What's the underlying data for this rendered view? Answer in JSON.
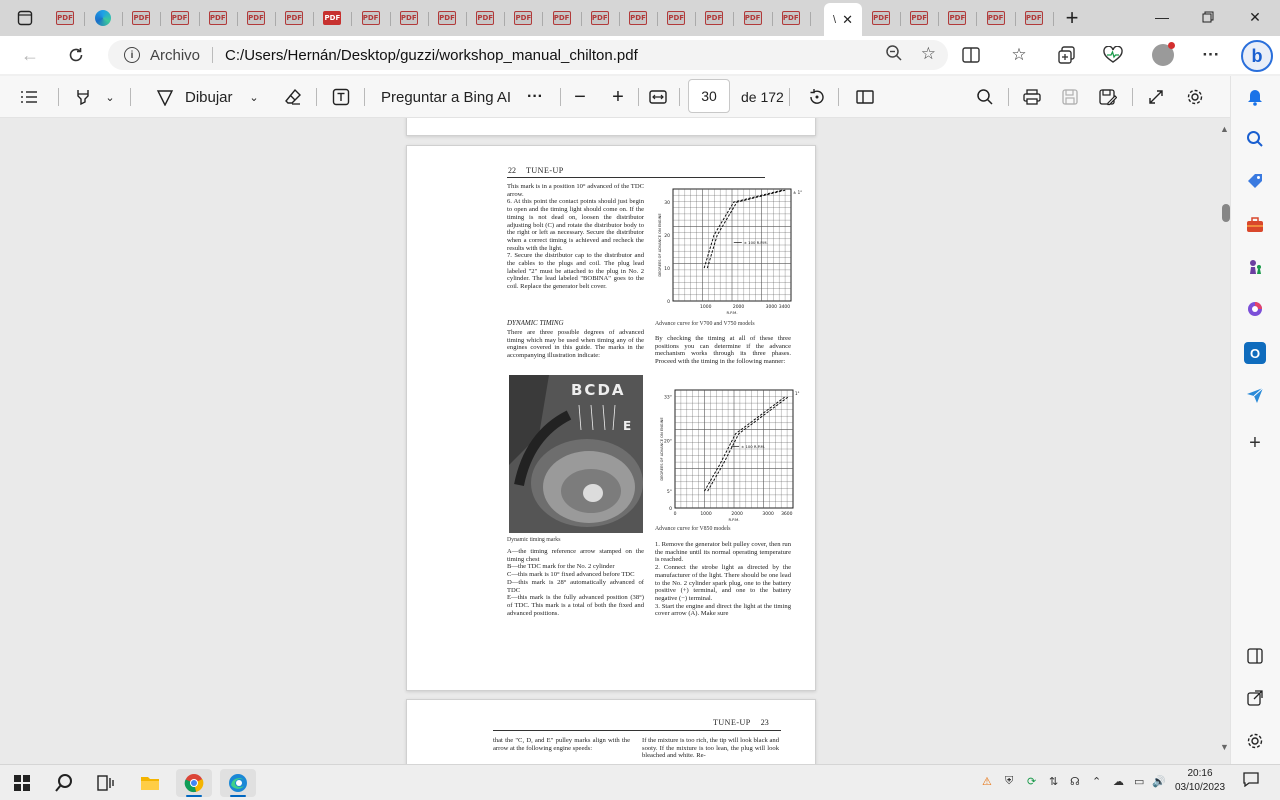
{
  "browser": {
    "tabs": [
      {
        "fav": "PDF"
      },
      {
        "fav": "edge"
      },
      {
        "fav": "PDF"
      },
      {
        "fav": "PDF"
      },
      {
        "fav": "PDF"
      },
      {
        "fav": "PDF"
      },
      {
        "fav": "PDF"
      },
      {
        "fav": "PDF",
        "strong": true
      },
      {
        "fav": "PDF"
      },
      {
        "fav": "PDF"
      },
      {
        "fav": "PDF"
      },
      {
        "fav": "PDF"
      },
      {
        "fav": "PDF"
      },
      {
        "fav": "PDF"
      },
      {
        "fav": "PDF"
      },
      {
        "fav": "PDF"
      },
      {
        "fav": "PDF"
      },
      {
        "fav": "PDF"
      },
      {
        "fav": "PDF"
      },
      {
        "fav": "PDF"
      },
      {
        "fav": "PDF"
      },
      {
        "fav": "PDF"
      },
      {
        "fav": "PDF"
      },
      {
        "fav": "PDF"
      },
      {
        "fav": "PDF"
      }
    ],
    "active_tab_text": "\\",
    "address": {
      "label": "Archivo",
      "url": "C:/Users/Hernán/Desktop/guzzi/workshop_manual_chilton.pdf"
    }
  },
  "pdf_toolbar": {
    "draw_label": "Dibujar",
    "ask_bing_label": "Preguntar a Bing AI",
    "more": "···",
    "page_current": "30",
    "page_total": "de 172"
  },
  "page22": {
    "header_num": "22",
    "header_title": "TUNE-UP",
    "left_col_1": "This mark is in a position 10° advanced of the TDC arrow.\n6. At this point the contact points should just begin to open and the timing light should come on. If the timing is not dead on, loosen the distributor adjusting bolt (C) and rotate the distributor body to the right or left as necessary. Secure the distributor when a correct timing is achieved and recheck the results with the light.\n7. Secure the distributor cap to the distributor and the cables to the plugs and coil. The plug lead labeled \"2\" must be attached to the plug in No. 2 cylinder. The lead labeled \"BOBINA\" goes to the coil. Replace the generator belt cover.",
    "section": "DYNAMIC TIMING",
    "left_col_2": "There are three possible degrees of advanced timing which may be used when timing any of the engines covered in this guide. The marks in the accompanying illustration indicate:",
    "photo_caption": "Dynamic timing marks",
    "photo_letters": "BCDA",
    "photo_letter_e": "E",
    "left_col_3": "A—the timing reference arrow stamped on the timing chest\nB—the TDC mark for the No. 2 cylinder\nC—this mark is 10° fixed advanced before TDC\nD—this mark is 28° automatically advanced of TDC\nE—this mark is the fully advanced position (38°) of TDC. This mark is a total of both the fixed and advanced positions.",
    "chart1_caption": "Advance curve for V700 and V750 models",
    "right_col_1": "By checking the timing at all of these three positions you can determine if the advance mechanism works through its three phases. Proceed with the timing in the following manner:",
    "chart2_caption": "Advance curve for V850 models",
    "right_col_2": "1. Remove the generator belt pulley cover, then run the machine until its normal operating temperature is reached.\n2. Connect the strobe light as directed by the manufacturer of the light. There should be one lead to the No. 2 cylinder spark plug, one to the battery positive (+) terminal, and one to the battery negative (−) terminal.\n3. Start the engine and direct the light at the timing cover arrow (A). Make sure"
  },
  "page23": {
    "header_title": "TUNE-UP",
    "header_num": "23",
    "left": "that the \"C, D, and E\" pulley marks align with the arrow at the following engine speeds:",
    "right": "If the mixture is too rich, the tip will look black and sooty. If the mixture is too lean, the plug will look bleached and white. Re-"
  },
  "charts": [
    {
      "ylabel": "DEGREES OF ADVANCE ON ENGINE",
      "xlabel": "R.P.M.",
      "x_ticks": [
        "1000",
        "2000",
        "3000",
        "3400"
      ],
      "y_ticks": [
        "0",
        "10",
        "20",
        "30"
      ],
      "annotation": "± 100 R.P.M.",
      "end_label": "± 1°",
      "xlim": [
        0,
        3600
      ],
      "ylim": [
        0,
        34
      ],
      "curve": [
        [
          1000,
          10
        ],
        [
          1300,
          20
        ],
        [
          1900,
          30
        ],
        [
          3400,
          38
        ]
      ]
    },
    {
      "ylabel": "DEGREES OF ADVANCE ON ENGINE",
      "xlabel": "R.P.M.",
      "x_ticks": [
        "0",
        "1000",
        "2000",
        "3000",
        "3600"
      ],
      "y_ticks": [
        "0",
        "5°",
        "20°",
        "33°"
      ],
      "annotation": "± 100 R.P.M.",
      "end_label": "1°",
      "xlim": [
        0,
        3800
      ],
      "ylim": [
        0,
        35
      ],
      "curve": [
        [
          1000,
          5
        ],
        [
          1500,
          13
        ],
        [
          2000,
          22
        ],
        [
          3600,
          33
        ]
      ]
    }
  ],
  "taskbar": {
    "clock_time": "20:16",
    "clock_date": "03/10/2023"
  },
  "colors": {
    "accent": "#0067c0",
    "pdf_red": "#c7312f",
    "bing_blue": "#2a6fdb"
  }
}
